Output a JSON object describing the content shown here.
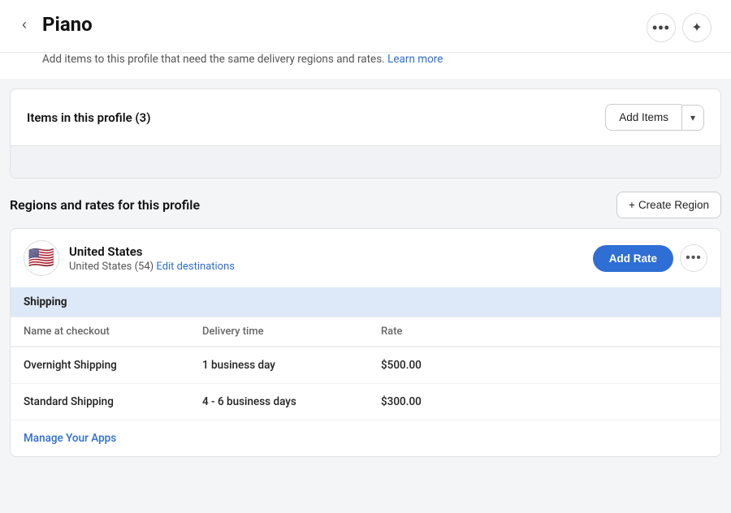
{
  "header": {
    "title": "Piano",
    "back_label": "‹",
    "more_icon": "•••",
    "sparkle_icon": "✦"
  },
  "subtitle": {
    "text": "Add items to this profile that need the same delivery regions and rates.",
    "learn_more": "Learn more"
  },
  "items_section": {
    "title": "Items in this profile (3)",
    "add_items_label": "Add Items",
    "dropdown_arrow": "▾"
  },
  "regions_section": {
    "title": "Regions and rates for this profile",
    "create_region_label": "Create Region",
    "create_region_prefix": "+ "
  },
  "us_region": {
    "flag": "🇺🇸",
    "name": "United States",
    "sub": "United States (54)",
    "edit_destinations": "Edit destinations",
    "add_rate_label": "Add Rate",
    "more_icon": "•••"
  },
  "shipping_table": {
    "section_label": "Shipping",
    "columns": {
      "name": "Name at checkout",
      "delivery": "Delivery time",
      "rate": "Rate"
    },
    "rows": [
      {
        "name": "Overnight Shipping",
        "delivery": "1 business day",
        "rate": "$500.00"
      },
      {
        "name": "Standard Shipping",
        "delivery": "4 - 6 business days",
        "rate": "$300.00"
      }
    ]
  },
  "manage_apps": {
    "label": "Manage Your Apps"
  }
}
